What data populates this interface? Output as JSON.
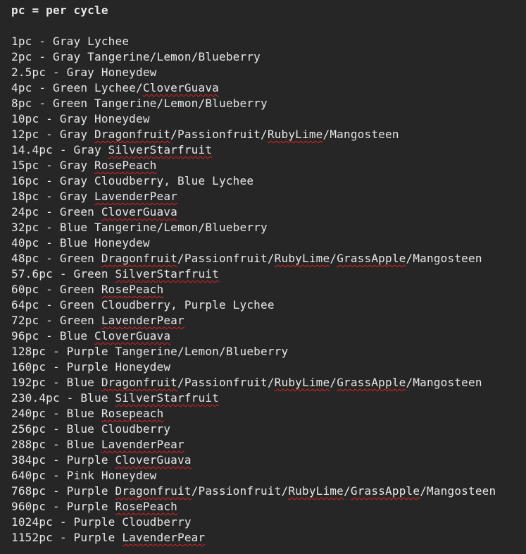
{
  "header": "pc = per cycle",
  "lines": [
    [
      {
        "t": "1pc - Gray Lychee"
      }
    ],
    [
      {
        "t": "2pc - Gray Tangerine/Lemon/Blueberry"
      }
    ],
    [
      {
        "t": "2.5pc - Gray Honeydew"
      }
    ],
    [
      {
        "t": "4pc - Green Lychee/"
      },
      {
        "t": "CloverGuava",
        "err": true
      }
    ],
    [
      {
        "t": "8pc - Green Tangerine/Lemon/Blueberry"
      }
    ],
    [
      {
        "t": "10pc - Gray Honeydew"
      }
    ],
    [
      {
        "t": "12pc - Gray "
      },
      {
        "t": "Dragonfruit",
        "err": true
      },
      {
        "t": "/Passionfruit/"
      },
      {
        "t": "RubyLime",
        "err": true
      },
      {
        "t": "/Mangosteen"
      }
    ],
    [
      {
        "t": "14.4pc - Gray "
      },
      {
        "t": "SilverStarfruit",
        "err": true
      }
    ],
    [
      {
        "t": "15pc - Gray "
      },
      {
        "t": "RosePeach",
        "err": true
      }
    ],
    [
      {
        "t": "16pc - Gray Cloudberry, Blue Lychee"
      }
    ],
    [
      {
        "t": "18pc - Gray "
      },
      {
        "t": "LavenderPear",
        "err": true
      }
    ],
    [
      {
        "t": "24pc - Green "
      },
      {
        "t": "CloverGuava",
        "err": true
      }
    ],
    [
      {
        "t": "32pc - Blue Tangerine/Lemon/Blueberry"
      }
    ],
    [
      {
        "t": "40pc - Blue Honeydew"
      }
    ],
    [
      {
        "t": "48pc - Green "
      },
      {
        "t": "Dragonfruit",
        "err": true
      },
      {
        "t": "/Passionfruit/"
      },
      {
        "t": "RubyLime",
        "err": true
      },
      {
        "t": "/"
      },
      {
        "t": "GrassApple",
        "err": true
      },
      {
        "t": "/Mangosteen"
      }
    ],
    [
      {
        "t": "57.6pc - Green "
      },
      {
        "t": "SilverStarfruit",
        "err": true
      }
    ],
    [
      {
        "t": "60pc - Green "
      },
      {
        "t": "RosePeach",
        "err": true
      }
    ],
    [
      {
        "t": "64pc - Green Cloudberry, Purple Lychee"
      }
    ],
    [
      {
        "t": "72pc - Green "
      },
      {
        "t": "LavenderPear",
        "err": true
      }
    ],
    [
      {
        "t": "96pc - Blue "
      },
      {
        "t": "CloverGuava",
        "err": true
      }
    ],
    [
      {
        "t": "128pc - Purple Tangerine/Lemon/Blueberry"
      }
    ],
    [
      {
        "t": "160pc - Purple Honeydew"
      }
    ],
    [
      {
        "t": "192pc - Blue "
      },
      {
        "t": "Dragonfruit",
        "err": true
      },
      {
        "t": "/Passionfruit/"
      },
      {
        "t": "RubyLime",
        "err": true
      },
      {
        "t": "/"
      },
      {
        "t": "GrassApple",
        "err": true
      },
      {
        "t": "/Mangosteen"
      }
    ],
    [
      {
        "t": "230.4pc - Blue "
      },
      {
        "t": "SilverStarfruit",
        "err": true
      }
    ],
    [
      {
        "t": "240pc - Blue "
      },
      {
        "t": "Rosepeach",
        "err": true
      }
    ],
    [
      {
        "t": "256pc - Blue Cloudberry"
      }
    ],
    [
      {
        "t": "288pc - Blue "
      },
      {
        "t": "LavenderPear",
        "err": true
      }
    ],
    [
      {
        "t": "384pc - Purple "
      },
      {
        "t": "CloverGuava",
        "err": true
      }
    ],
    [
      {
        "t": "640pc - Pink Honeydew"
      }
    ],
    [
      {
        "t": "768pc - Purple "
      },
      {
        "t": "Dragonfruit",
        "err": true
      },
      {
        "t": "/Passionfruit/"
      },
      {
        "t": "RubyLime",
        "err": true
      },
      {
        "t": "/"
      },
      {
        "t": "GrassApple",
        "err": true
      },
      {
        "t": "/Mangosteen"
      }
    ],
    [
      {
        "t": "960pc - Purple "
      },
      {
        "t": "RosePeach",
        "err": true
      }
    ],
    [
      {
        "t": "1024pc - Purple Cloudberry"
      }
    ],
    [
      {
        "t": "1152pc - Purple "
      },
      {
        "t": "LavenderPear",
        "err": true
      }
    ]
  ]
}
